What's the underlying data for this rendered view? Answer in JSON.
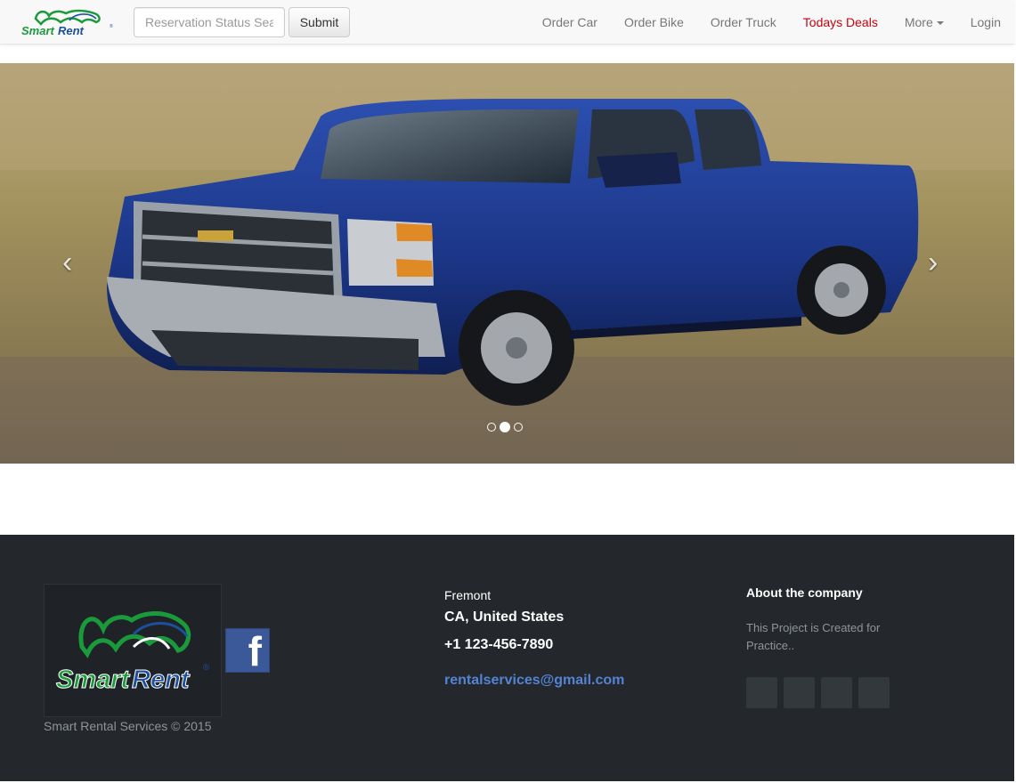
{
  "nav": {
    "brand": "SmartRent",
    "search_placeholder": "Reservation Status Search",
    "submit_label": "Submit",
    "links": [
      "Order Car",
      "Order Bike",
      "Order Truck",
      "Todays Deals",
      "More",
      "Login"
    ],
    "deal_color": "#c9000f"
  },
  "carousel": {
    "prev_icon": "‹",
    "next_icon": "›",
    "slide_count": 3,
    "active_slide": 2
  },
  "footer": {
    "copyright": "Smart Rental Services © 2015",
    "city": "Fremont",
    "state": "CA, United States",
    "phone": "+1 123-456-7890",
    "email": "rentalservices@gmail.com",
    "about_title": "About the company",
    "about_text": "This Project is Created for Practice..",
    "fb_glyph": "f"
  },
  "colors": {
    "footer_bg": "#24282c",
    "link_blue": "#5383d3",
    "brand_green": "#1a9a3a",
    "brand_blue": "#1c4f9c"
  }
}
